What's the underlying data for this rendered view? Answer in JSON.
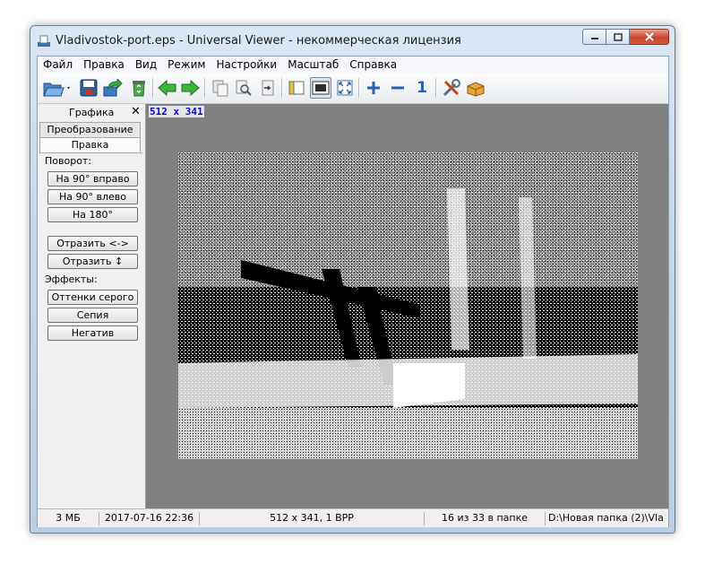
{
  "window": {
    "title": "Vladivostok-port.eps - Universal Viewer - некоммерческая лицензия"
  },
  "menu": [
    "Файл",
    "Правка",
    "Вид",
    "Режим",
    "Настройки",
    "Масштаб",
    "Справка"
  ],
  "toolbar": {
    "icons": [
      "open-folder-icon",
      "save-icon",
      "export-icon",
      "recycle-bin-icon",
      "back-arrow-icon",
      "forward-arrow-icon",
      "copy-icon",
      "search-icon",
      "paste-icon",
      "panel-toggle-icon",
      "fit-window-icon",
      "fullscreen-icon",
      "zoom-in-icon",
      "zoom-out-icon",
      "original-size-icon",
      "tools-icon",
      "plugin-icon"
    ],
    "original_size_glyph": "1"
  },
  "panel": {
    "title": "Графика",
    "close_glyph": "✕",
    "tab_transform": "Преобразование",
    "tab_edit": "Правка",
    "rotate_label": "Поворот:",
    "rotate_right": "На 90° вправо",
    "rotate_left": "На 90° влево",
    "rotate_180": "На 180°",
    "flip_horizontal": "Отразить <->",
    "flip_vertical": "Отразить ↕",
    "effects_label": "Эффекты:",
    "grayscale": "Оттенки серого",
    "sepia": "Сепия",
    "negative": "Негатив"
  },
  "viewer": {
    "image_size": "512 x 341"
  },
  "status": {
    "file_size": "3 МБ",
    "date": "2017-07-16 22:36",
    "dimensions": "512 x 341, 1 BPP",
    "position": "16 из 33 в папке",
    "path": "D:\\Новая папка (2)\\Vla"
  },
  "colors": {
    "view_background": "#808080",
    "size_label": "#0000ee",
    "close_button": "#c7452b"
  }
}
